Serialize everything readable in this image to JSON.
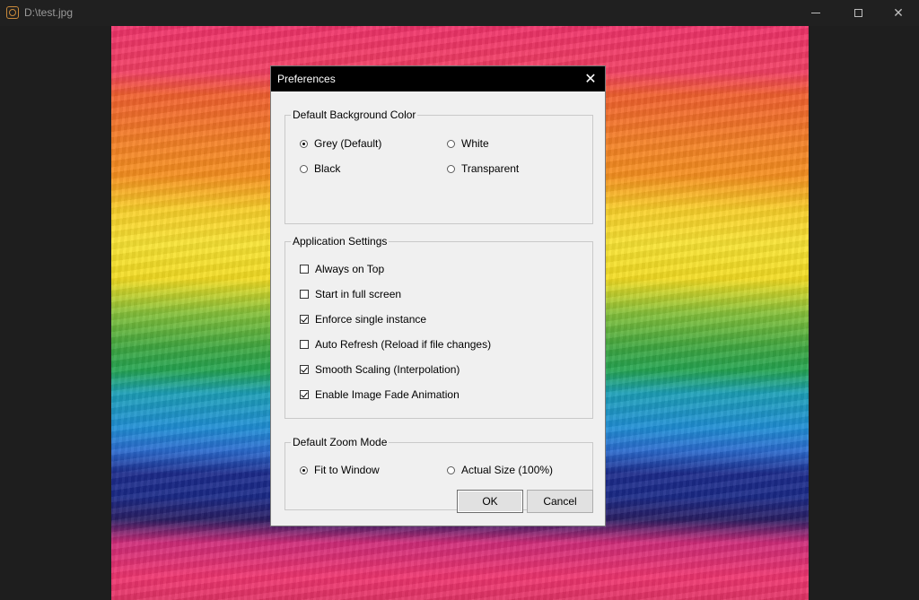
{
  "window": {
    "title": "D:\\test.jpg"
  },
  "dialog": {
    "title": "Preferences",
    "close_glyph": "✕",
    "background_group": {
      "label": "Default Background Color",
      "options": [
        {
          "label": "Grey (Default)",
          "selected": true
        },
        {
          "label": "White",
          "selected": false
        },
        {
          "label": "Black",
          "selected": false
        },
        {
          "label": "Transparent",
          "selected": false
        }
      ]
    },
    "app_settings_group": {
      "label": "Application Settings",
      "options": [
        {
          "label": "Always on Top",
          "checked": false
        },
        {
          "label": "Start in full screen",
          "checked": false
        },
        {
          "label": "Enforce single instance",
          "checked": true
        },
        {
          "label": "Auto Refresh (Reload if file changes)",
          "checked": false
        },
        {
          "label": "Smooth Scaling (Interpolation)",
          "checked": true
        },
        {
          "label": "Enable Image Fade Animation",
          "checked": true
        }
      ]
    },
    "zoom_group": {
      "label": "Default Zoom Mode",
      "options": [
        {
          "label": "Fit to Window",
          "selected": true
        },
        {
          "label": "Actual Size (100%)",
          "selected": false
        }
      ]
    },
    "ok_label": "OK",
    "cancel_label": "Cancel"
  },
  "icons": {
    "app": "app-icon",
    "minimize": "minimize-icon",
    "maximize": "maximize-icon",
    "close": "close-icon"
  }
}
